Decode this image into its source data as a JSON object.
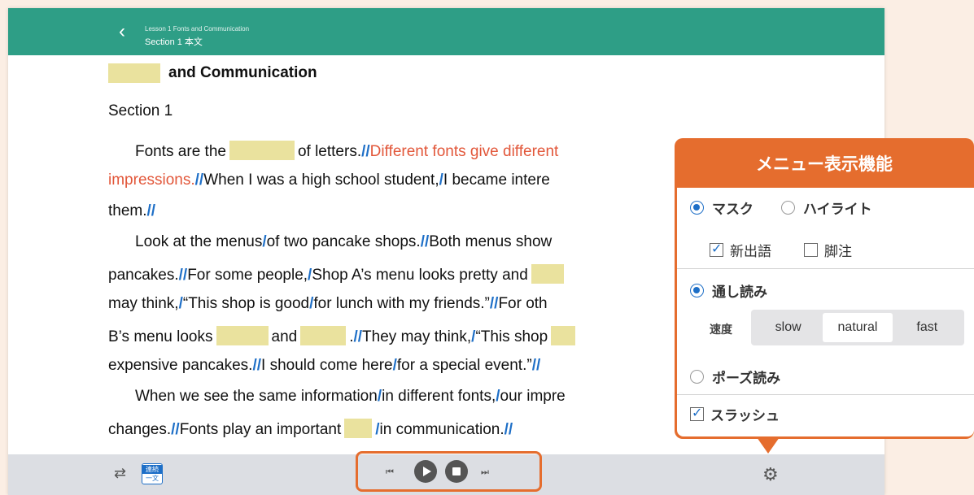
{
  "header": {
    "lesson": "Lesson 1  Fonts and Communication",
    "section": "Section 1   本文"
  },
  "doc": {
    "title_rest": "and Communication",
    "section_heading": "Section 1"
  },
  "text": {
    "l1_a": "Fonts are the",
    "l1_b": "of letters.",
    "l1_red": "Different fonts give different",
    "l2_red": "impressions.",
    "l2_b": "When I was a high school student,",
    "l2_c": "I became intere",
    "l3_a": "them.",
    "l4_a": "Look at the menus",
    "l4_b": "of two pancake shops.",
    "l4_c": "Both menus show",
    "l5_a": "pancakes.",
    "l5_b": "For some people,",
    "l5_c": "Shop A’s menu looks pretty and",
    "l6_a": "may think,",
    "l6_b": "“This shop is good",
    "l6_c": "for lunch with my friends.”",
    "l6_d": "For oth",
    "l7_a": "B’s menu looks",
    "l7_b": "and",
    "l7_c": ".",
    "l7_d": "They may think,",
    "l7_e": "“This shop",
    "l8_a": "expensive pancakes.",
    "l8_b": "I should come here",
    "l8_c": "for a special event.”",
    "l9_a": "When we see the same information",
    "l9_b": "in different fonts,",
    "l9_c": "our impre",
    "l10_a": "changes.",
    "l10_b": "Fonts play an important",
    "l10_c": "in communication.",
    "slash": "/",
    "dslash": "//"
  },
  "bottom": {
    "continuous_top": "連続",
    "continuous_bottom": "一文",
    "prev": "⏮",
    "next": "⏭",
    "repeat": "⇄",
    "gear": "⚙"
  },
  "popup": {
    "title": "メニュー表示機能",
    "mask": "マスク",
    "highlight": "ハイライト",
    "new_words": "新出語",
    "footnote": "脚注",
    "read_through": "通し読み",
    "speed_label": "速度",
    "speeds": [
      "slow",
      "natural",
      "fast"
    ],
    "pause_read": "ポーズ読み",
    "slash": "スラッシュ"
  },
  "colors": {
    "header": "#2e9e86",
    "accent": "#e56d2e",
    "mask": "#eae29e",
    "slash": "#1e6fc7",
    "red_text": "#e2573a"
  }
}
